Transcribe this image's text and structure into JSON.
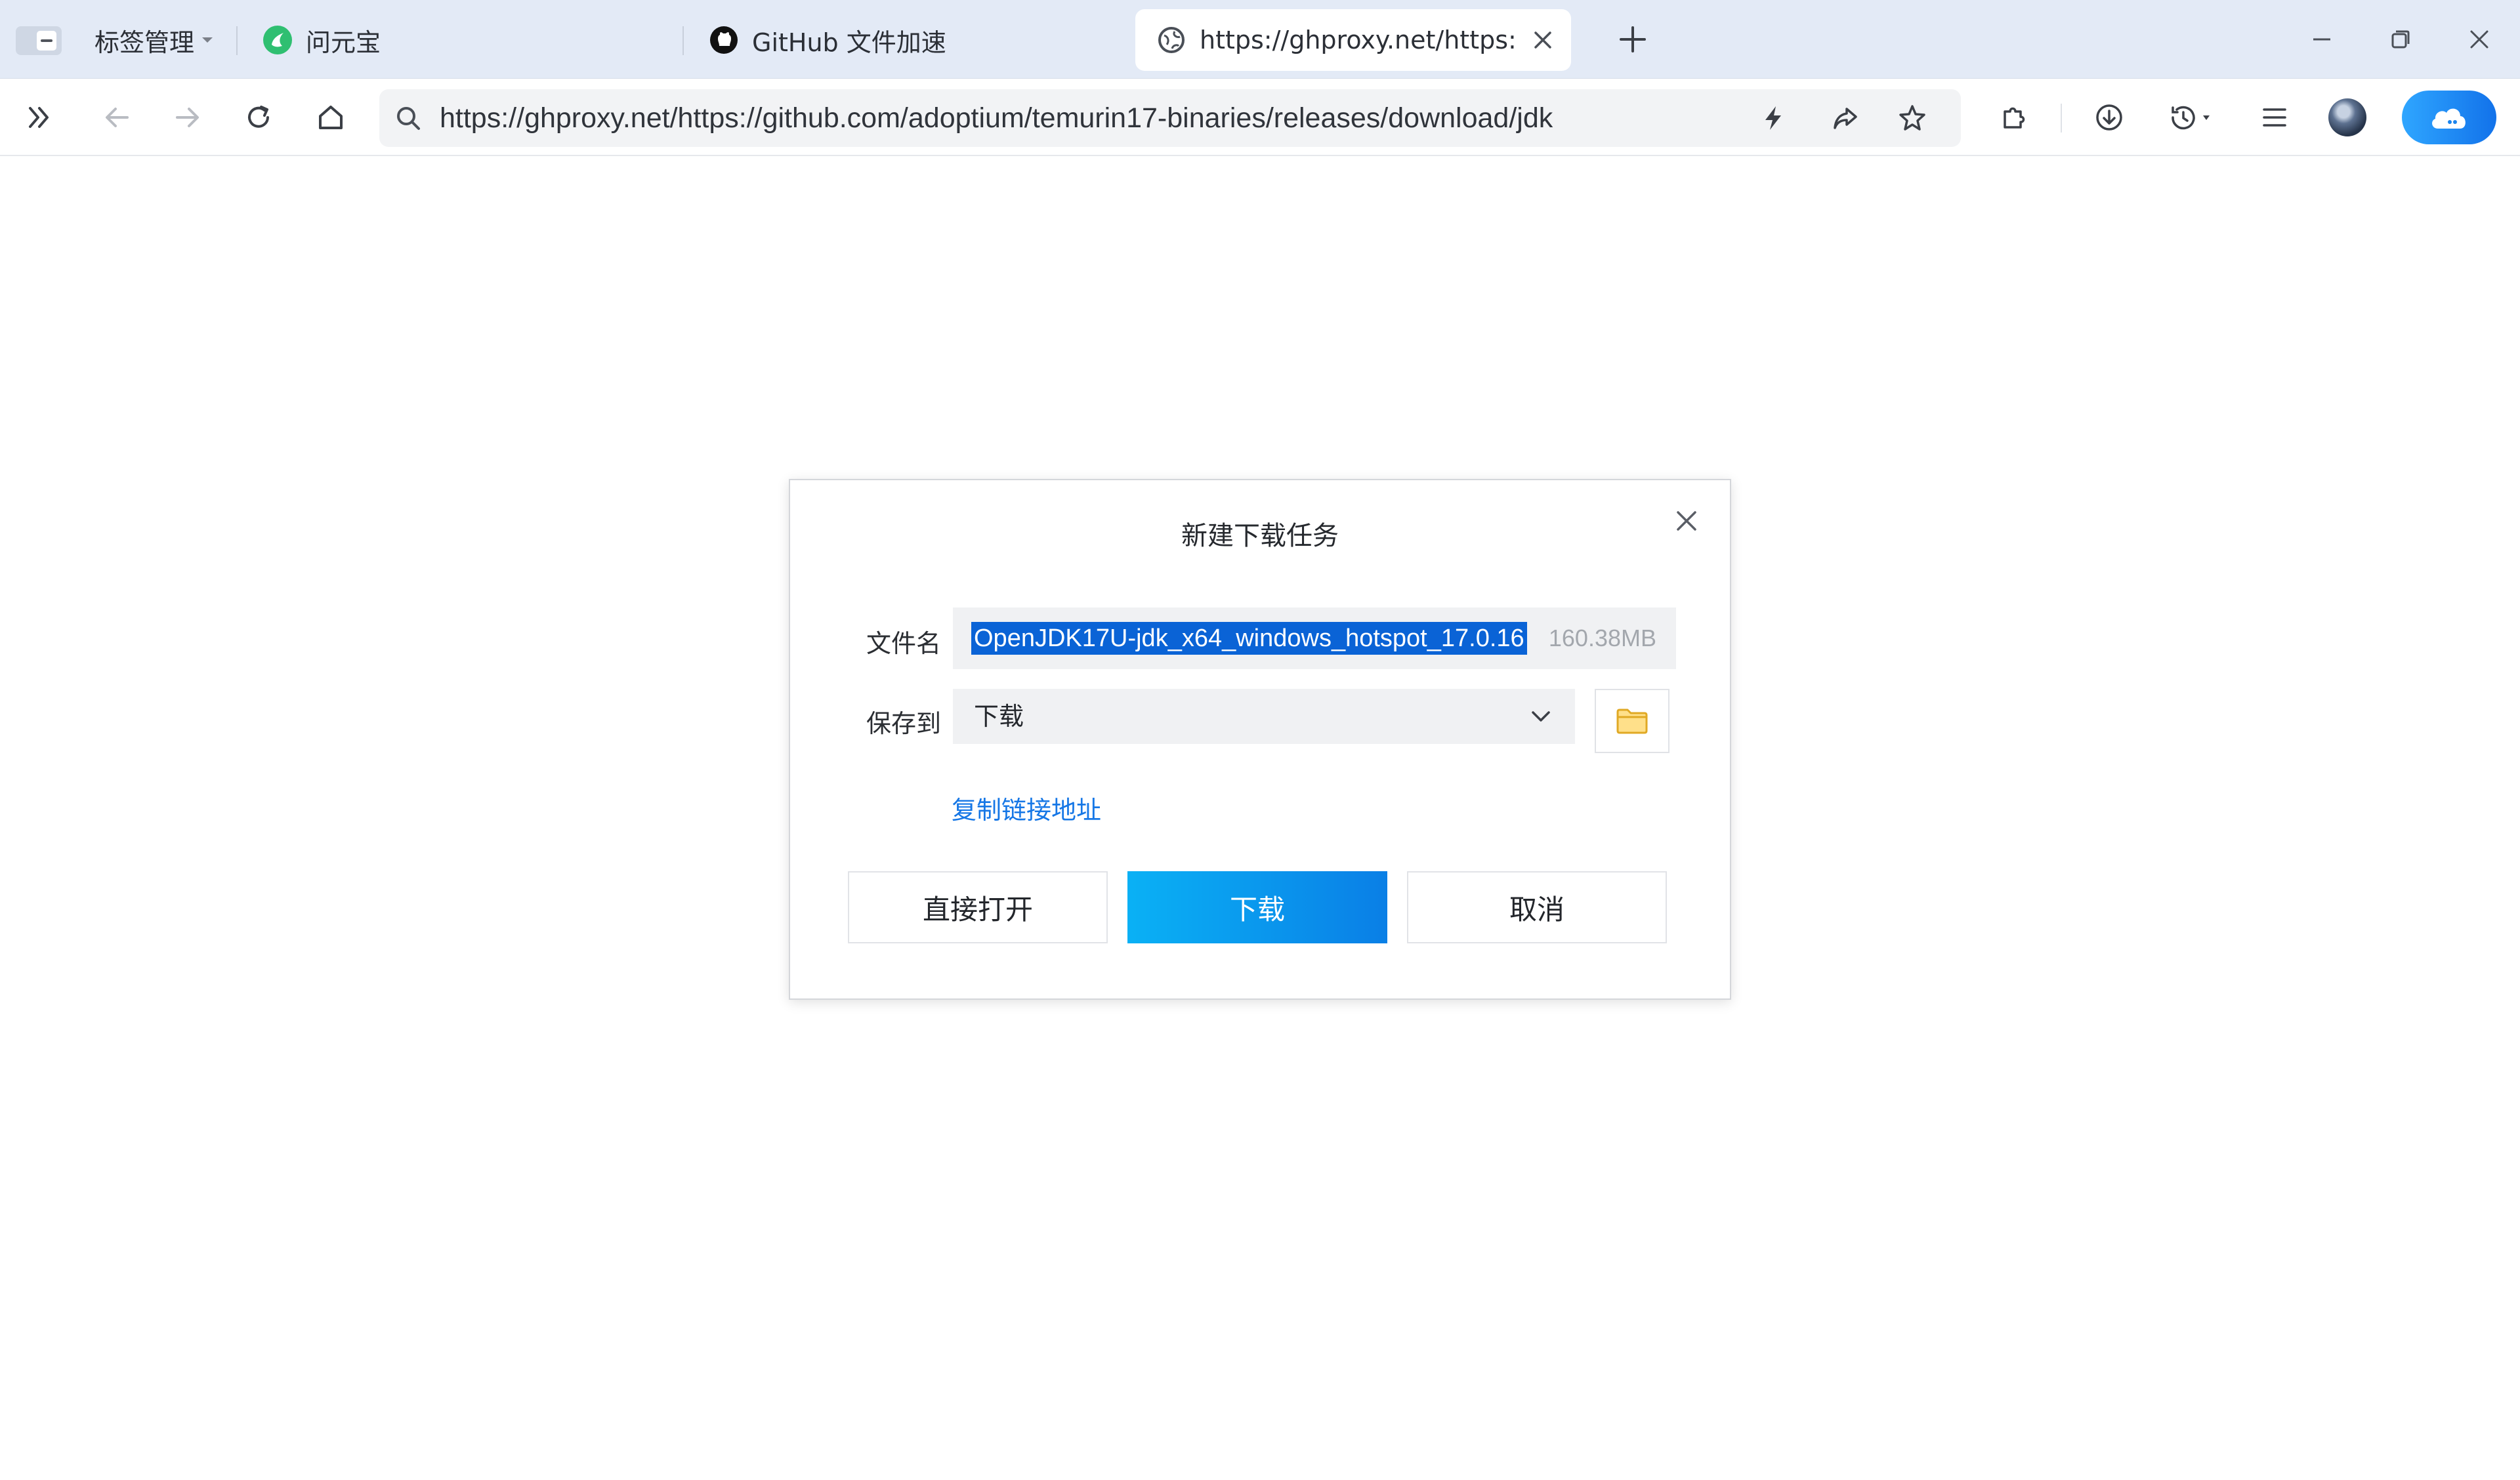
{
  "tabstrip": {
    "tab_manager_label": "标签管理",
    "tabs": [
      {
        "title": "问元宝",
        "icon": "yuanbao-icon"
      },
      {
        "title": "GitHub 文件加速",
        "icon": "github-icon"
      },
      {
        "title": "https://ghproxy.net/https://g",
        "icon": "globe-icon",
        "active": true
      }
    ]
  },
  "toolbar": {
    "url": "https://ghproxy.net/https://github.com/adoptium/temurin17-binaries/releases/download/jdk"
  },
  "dialog": {
    "title": "新建下载任务",
    "filename_label": "文件名",
    "filename_value": "OpenJDK17U-jdk_x64_windows_hotspot_17.0.16",
    "file_size": "160.38MB",
    "saveto_label": "保存到",
    "saveto_value": "下载",
    "copy_link": "复制链接地址",
    "buttons": {
      "open_direct": "直接打开",
      "download": "下载",
      "cancel": "取消"
    }
  },
  "colors": {
    "accent": "#0a7fe6",
    "selection": "#0a63d6",
    "link": "#1677e6",
    "tabstrip_bg": "#e3eaf6"
  }
}
